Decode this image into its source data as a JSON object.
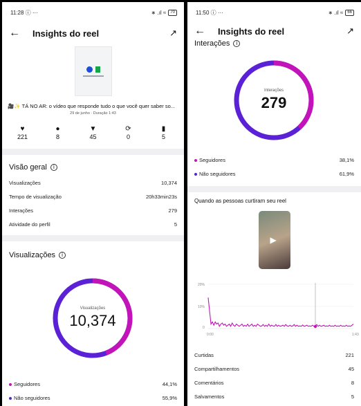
{
  "colors": {
    "accent_purple": "#5b21d6",
    "accent_magenta": "#c214b8",
    "divider": "#f0f0f2"
  },
  "left": {
    "status": {
      "time": "11:28 ⓘ ···",
      "icons": "∗ .ıl ≈",
      "battery": "70"
    },
    "header": {
      "title": "Insights do reel",
      "back_icon": "←",
      "trend_icon": "↗"
    },
    "caption": "🎥✨ TÁ NO AR: o vídeo que responde tudo o que você quer saber so...",
    "date": "29 de junho · Duração 1:43",
    "stats": [
      {
        "icon": "heart-icon",
        "glyph": "♥",
        "value": "221"
      },
      {
        "icon": "comment-icon",
        "glyph": "●",
        "value": "8"
      },
      {
        "icon": "share-icon",
        "glyph": "▼",
        "value": "45"
      },
      {
        "icon": "repost-icon",
        "glyph": "⟳",
        "value": "0"
      },
      {
        "icon": "save-icon",
        "glyph": "▮",
        "value": "5"
      }
    ],
    "overview": {
      "title": "Visão geral",
      "rows": [
        {
          "label": "Visualizações",
          "value": "10,374"
        },
        {
          "label": "Tempo de visualização",
          "value": "20h33min23s"
        },
        {
          "label": "Interações",
          "value": "279"
        },
        {
          "label": "Atividade do perfil",
          "value": "5"
        }
      ]
    },
    "views": {
      "title": "Visualizações",
      "donut_label": "Visualizações",
      "donut_value": "10,374",
      "followers_fraction": 0.441,
      "legend": [
        {
          "label": "Seguidores",
          "value": "44,1%",
          "color": "#c214b8"
        },
        {
          "label": "Não seguidores",
          "value": "55,9%",
          "color": "#5b21d6"
        }
      ]
    }
  },
  "right": {
    "status": {
      "time": "11:50 ⓘ ···",
      "icons": "∗ .ıl ≈",
      "battery": "66"
    },
    "header": {
      "title": "Insights do reel",
      "back_icon": "←",
      "trend_icon": "↗"
    },
    "interactions": {
      "title": "Interações",
      "donut_label": "Interações",
      "donut_value": "279",
      "followers_fraction": 0.381,
      "legend": [
        {
          "label": "Seguidores",
          "value": "38,1%",
          "color": "#c214b8"
        },
        {
          "label": "Não seguidores",
          "value": "61,9%",
          "color": "#5b21d6"
        }
      ]
    },
    "likes_section": {
      "title": "Quando as pessoas curtiram seu reel"
    },
    "chart_data": {
      "type": "line",
      "y_ticks": [
        "20%",
        "10%",
        "0"
      ],
      "x_ticks": [
        "0:00",
        "1:43"
      ],
      "ylim": [
        0,
        20
      ],
      "x": [
        0,
        1,
        2,
        3,
        4,
        5,
        6,
        7,
        8,
        9,
        10,
        11,
        12,
        13,
        14,
        15,
        16,
        17,
        18,
        19,
        20,
        21,
        22,
        23,
        24,
        25,
        26,
        27,
        28,
        29,
        30,
        31,
        32,
        33,
        34,
        35,
        36,
        37,
        38,
        39,
        40,
        41,
        42,
        43,
        44,
        45,
        46,
        47,
        48,
        49,
        50,
        51,
        52,
        53,
        54,
        55,
        56,
        57,
        58,
        59,
        60,
        61,
        62,
        63,
        64,
        65,
        66,
        67,
        68,
        69,
        70,
        71,
        72,
        73,
        74,
        75,
        76,
        77,
        78,
        79,
        80,
        81,
        82,
        83,
        84,
        85,
        86,
        87,
        88,
        89,
        90,
        91,
        92,
        93,
        94,
        95,
        96,
        97,
        98,
        99,
        100,
        101,
        102,
        103
      ],
      "values": [
        14,
        8,
        2,
        3,
        1.5,
        3,
        2,
        2.5,
        1,
        2,
        2.5,
        1.5,
        2,
        1,
        1.5,
        2,
        1,
        2.5,
        1.5,
        1,
        2,
        1.5,
        1,
        1.5,
        2,
        1,
        1.5,
        1,
        2,
        1,
        1.5,
        2,
        1,
        1.5,
        1,
        2,
        1.5,
        1,
        1.2,
        1.8,
        1,
        1.5,
        1,
        2,
        1,
        1.5,
        1.2,
        1,
        1.8,
        1,
        1.5,
        1,
        1.2,
        1.5,
        1,
        1.8,
        1.2,
        1,
        1.5,
        1,
        1.2,
        1.8,
        1,
        1.5,
        1,
        1.2,
        1,
        1.6,
        1,
        1.2,
        1.5,
        1,
        1.2,
        1,
        1.5,
        1,
        1.2,
        1.8,
        1,
        1.5,
        1,
        1.2,
        1.5,
        1,
        1.2,
        1,
        1.5,
        1,
        1.2,
        1,
        1.5,
        1,
        1.2,
        1,
        1.5,
        1,
        1.2,
        1,
        1.5,
        1,
        1.2,
        1,
        1.5,
        2
      ]
    },
    "rows": [
      {
        "label": "Curtidas",
        "value": "221"
      },
      {
        "label": "Compartilhamentos",
        "value": "45"
      },
      {
        "label": "Comentários",
        "value": "8"
      },
      {
        "label": "Salvamentos",
        "value": "5"
      }
    ]
  }
}
